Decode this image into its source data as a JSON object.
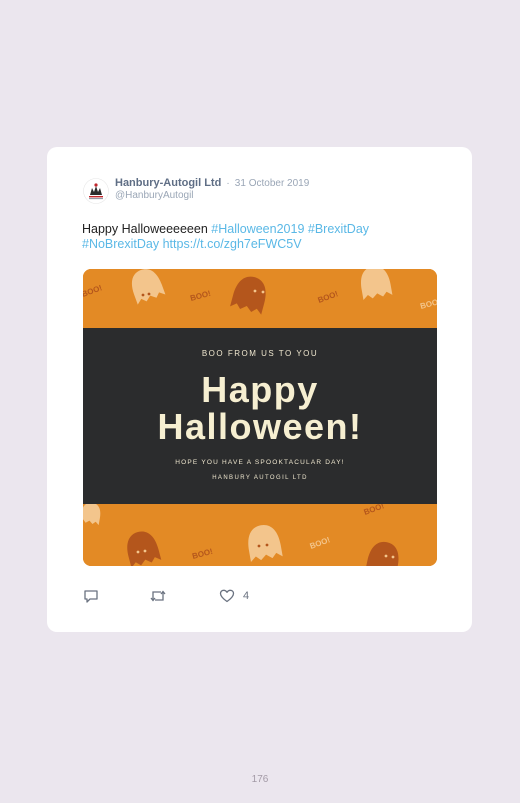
{
  "tweet": {
    "author_name": "Hanbury-Autogil Ltd",
    "separator": "·",
    "date": "31 October 2019",
    "handle": "@HanburyAutogil",
    "text_plain": "Happy Halloweeeeeen ",
    "hashtag_1": "#Halloween2019",
    "hashtag_2": "#BrexitDay",
    "hashtag_3": "#NoBrexitDay",
    "url": "https://t.co/zgh7eFWC5V",
    "like_count": "4"
  },
  "image": {
    "line_top": "BOO FROM US TO YOU",
    "title_line_1": "Happy",
    "title_line_2": "Halloween!",
    "line_bottom": "HOPE YOU HAVE A SPOOKTACULAR DAY!",
    "signature": "HANBURY AUTOGIL LTD",
    "boo_text": "BOO!"
  },
  "page": {
    "number": "176"
  },
  "colors": {
    "background": "#ebe6ee",
    "card": "#ffffff",
    "link": "#5ab8e6",
    "image_orange": "#e38a25",
    "image_dark": "#2b2c2d",
    "ghost_light": "#f3c58c",
    "ghost_dark": "#b4561c"
  },
  "icons": {
    "reply": "reply-icon",
    "retweet": "retweet-icon",
    "like": "heart-icon"
  }
}
